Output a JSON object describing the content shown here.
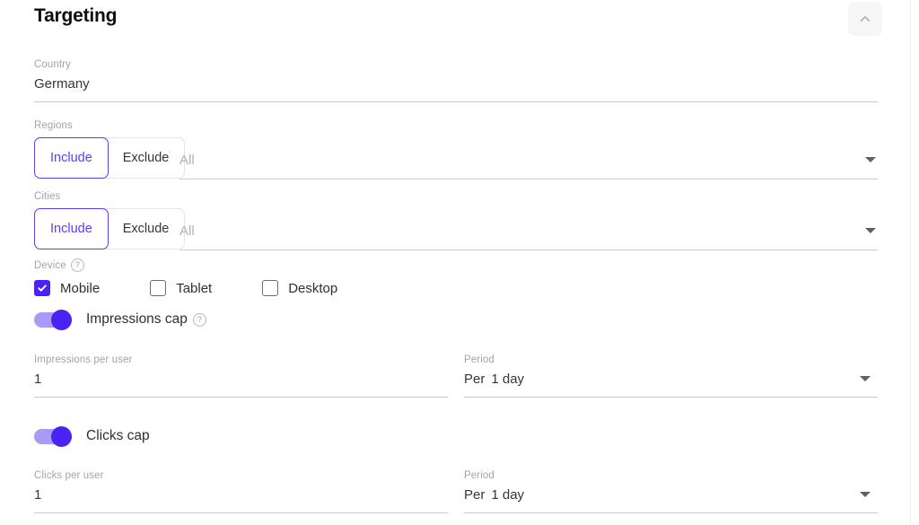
{
  "panel": {
    "title": "Targeting",
    "collapse_icon": "chevron-up-icon",
    "accent_color": "#5b3df5",
    "toggle_on_color": "#4b22f4",
    "toggle_track_color": "#a79bf5"
  },
  "country": {
    "label": "Country",
    "value": "Germany"
  },
  "regions": {
    "label": "Regions",
    "include_label": "Include",
    "exclude_label": "Exclude",
    "selected_mode": "Include",
    "select_value": "All",
    "caret_icon": "chevron-down-icon"
  },
  "cities": {
    "label": "Cities",
    "include_label": "Include",
    "exclude_label": "Exclude",
    "selected_mode": "Include",
    "select_value": "All",
    "caret_icon": "chevron-down-icon"
  },
  "device": {
    "label": "Device",
    "help_icon": "help-circle-icon",
    "options": [
      {
        "label": "Mobile",
        "checked": true
      },
      {
        "label": "Tablet",
        "checked": false
      },
      {
        "label": "Desktop",
        "checked": false
      }
    ]
  },
  "impressions_cap": {
    "toggle_label": "Impressions cap",
    "toggle_on": true,
    "help_icon": "help-circle-icon",
    "per_user": {
      "label": "Impressions per user",
      "value": "1"
    },
    "period": {
      "label": "Period",
      "prefix": "Per",
      "value": "1 day",
      "caret_icon": "chevron-down-icon"
    }
  },
  "clicks_cap": {
    "toggle_label": "Clicks cap",
    "toggle_on": true,
    "per_user": {
      "label": "Clicks per user",
      "value": "1"
    },
    "period": {
      "label": "Period",
      "prefix": "Per",
      "value": "1 day",
      "caret_icon": "chevron-down-icon"
    }
  }
}
